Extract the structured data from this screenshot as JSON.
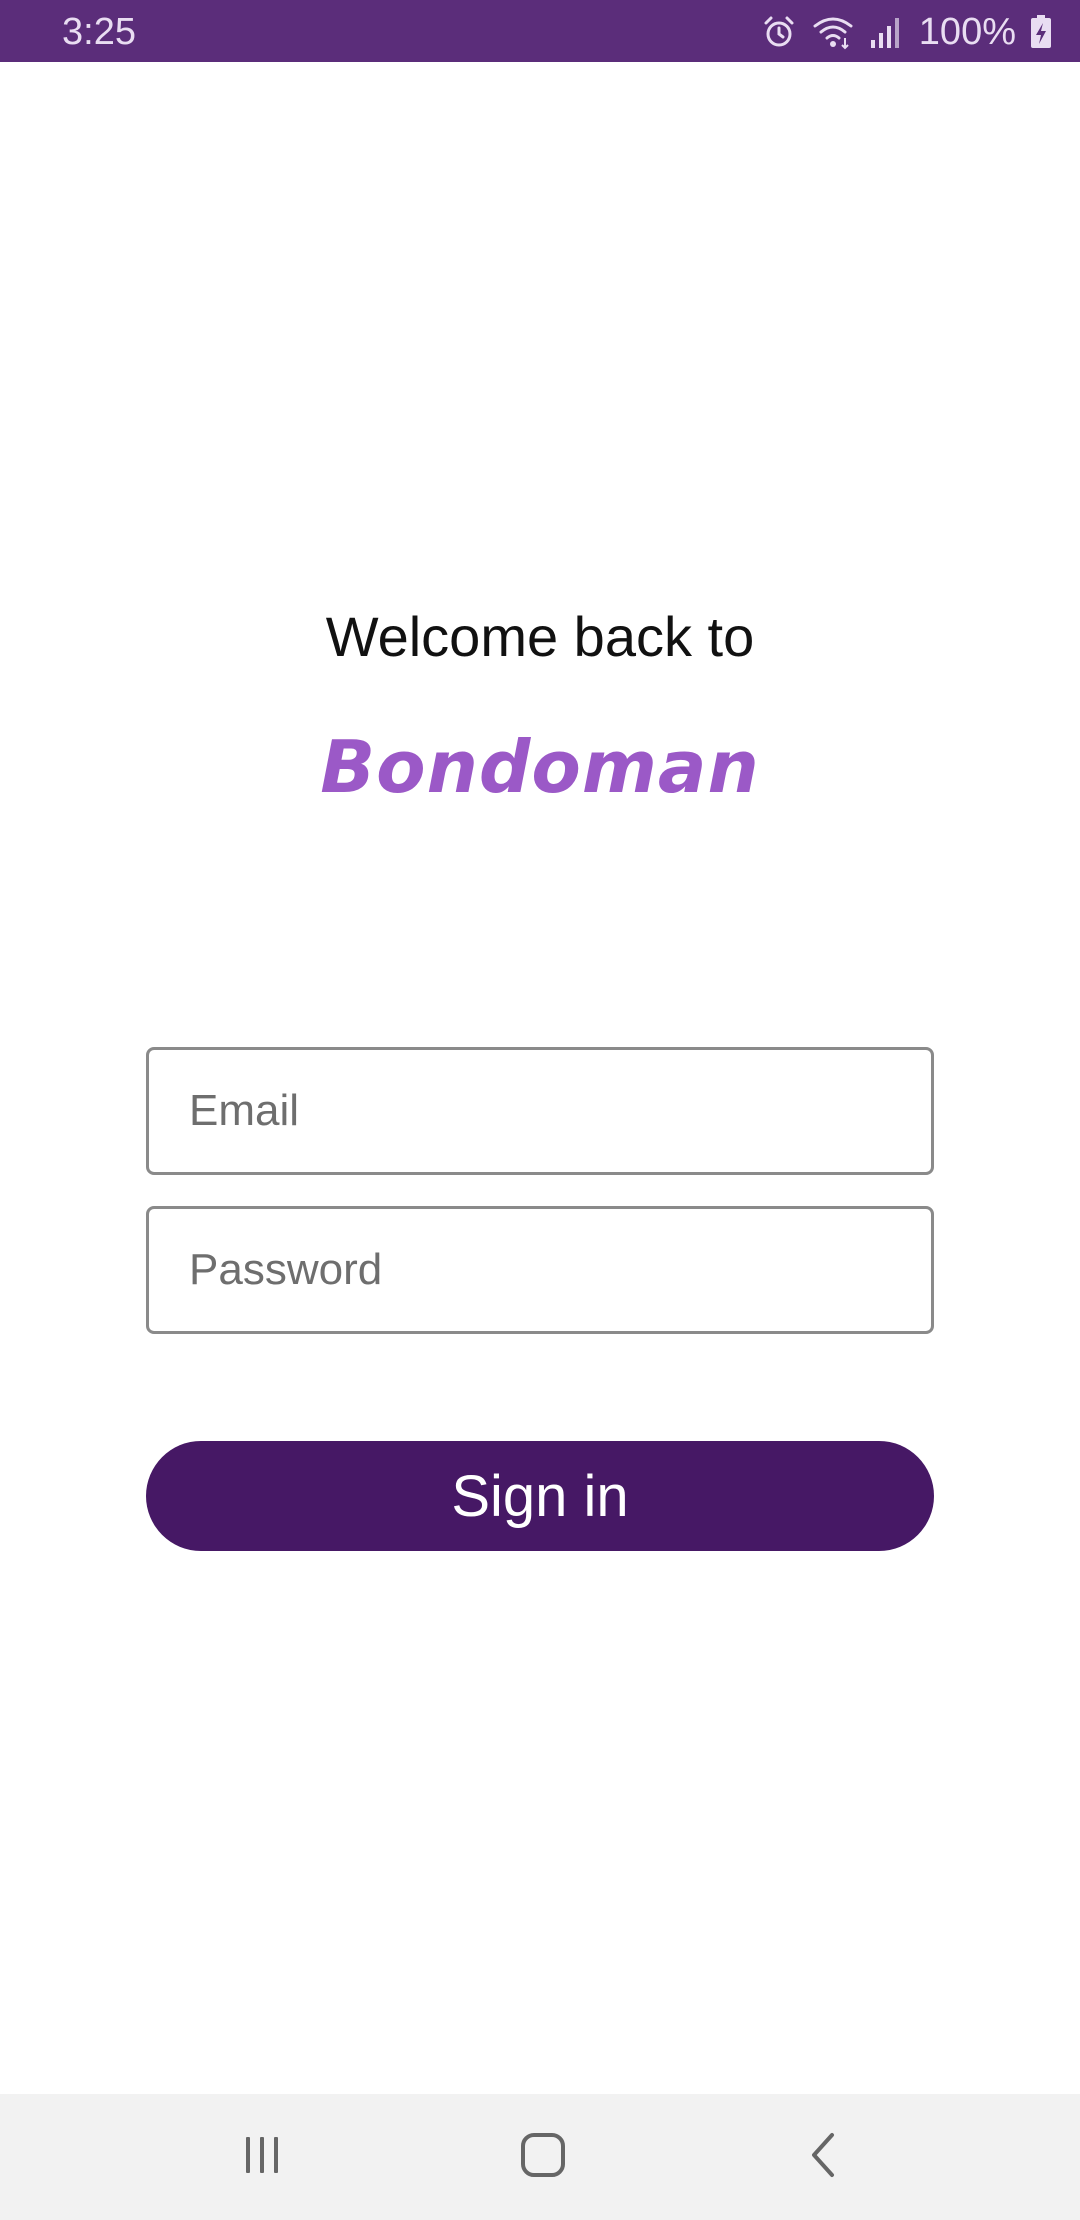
{
  "status_bar": {
    "time": "3:25",
    "battery": "100%",
    "icons": [
      "alarm-icon",
      "wifi-icon",
      "signal-icon",
      "battery-charging-icon"
    ],
    "background_color": "#5b2d7a"
  },
  "welcome": {
    "title": "Welcome back to",
    "brand": "Bondoman",
    "brand_color": "#9b59c7"
  },
  "form": {
    "email_placeholder": "Email",
    "email_value": "",
    "password_placeholder": "Password",
    "password_value": "",
    "signin_label": "Sign in",
    "button_color": "#461865"
  },
  "nav_bar": {
    "buttons": [
      "recents-icon",
      "home-icon",
      "back-icon"
    ]
  }
}
